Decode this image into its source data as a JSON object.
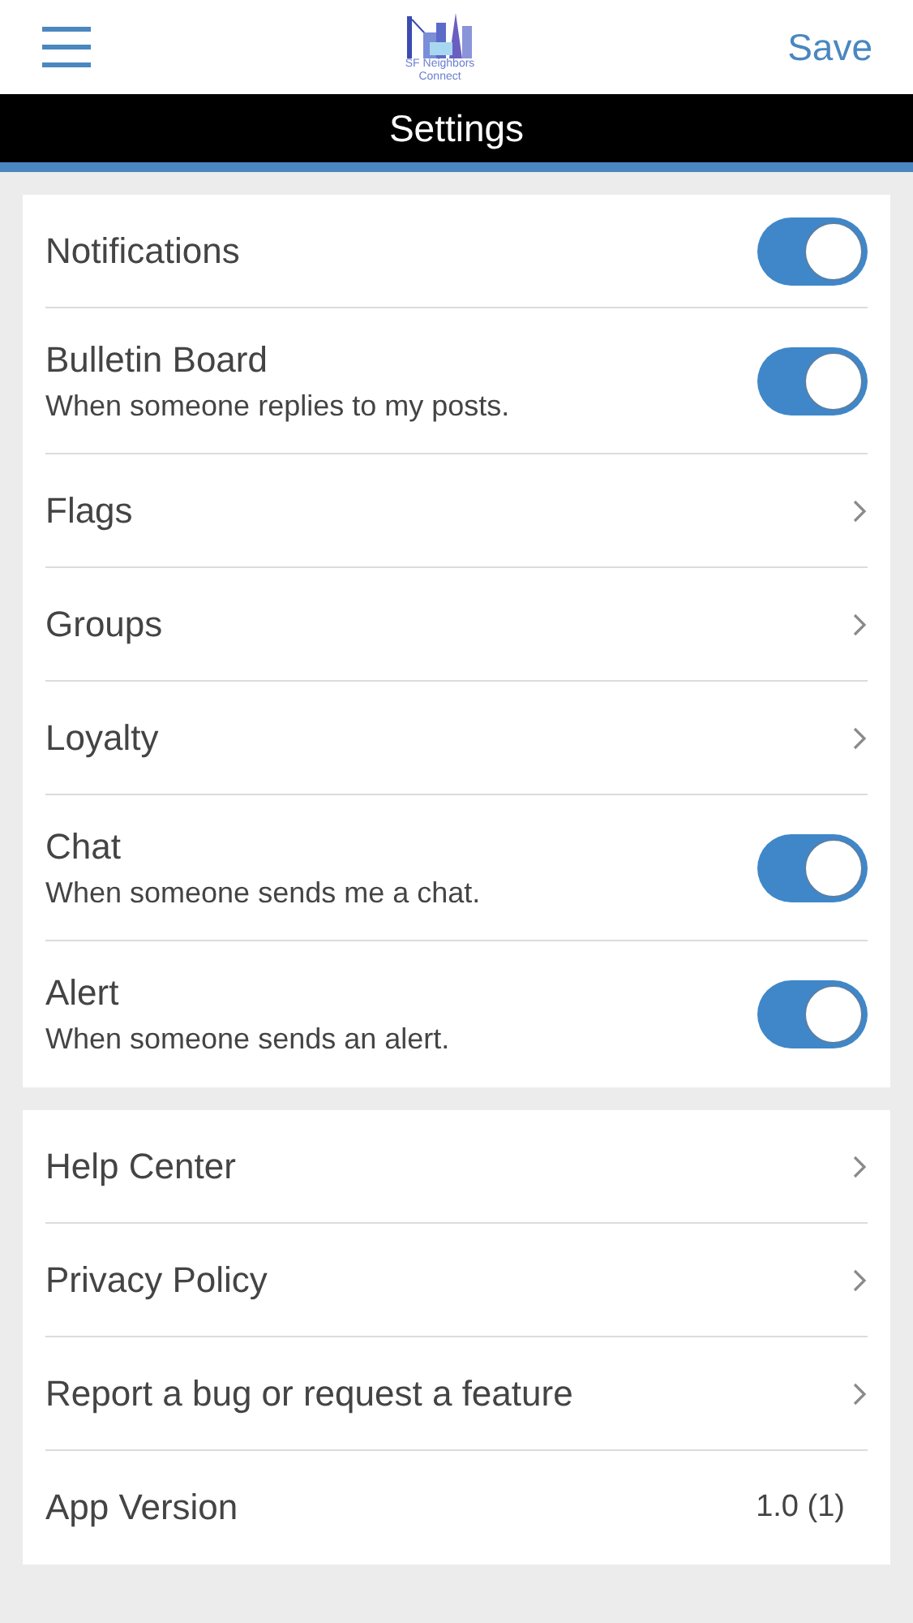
{
  "header": {
    "logo_text": [
      "SF Neighbors",
      "Connect"
    ],
    "save": "Save"
  },
  "title": "Settings",
  "sections": [
    {
      "items": [
        {
          "kind": "toggle",
          "label": "Notifications",
          "on": true
        },
        {
          "kind": "toggle",
          "label": "Bulletin Board",
          "description": "When someone replies to my posts.",
          "on": true
        },
        {
          "kind": "link",
          "label": "Flags"
        },
        {
          "kind": "link",
          "label": "Groups"
        },
        {
          "kind": "link",
          "label": "Loyalty"
        },
        {
          "kind": "toggle",
          "label": "Chat",
          "description": "When someone sends me a chat.",
          "on": true
        },
        {
          "kind": "toggle",
          "label": "Alert",
          "description": "When someone sends an alert.",
          "on": true
        }
      ]
    },
    {
      "items": [
        {
          "kind": "link",
          "label": "Help Center"
        },
        {
          "kind": "link",
          "label": "Privacy Policy"
        },
        {
          "kind": "link",
          "label": "Report a bug or request a feature"
        },
        {
          "kind": "value",
          "label": "App Version",
          "value": "1.0 (1)"
        }
      ]
    }
  ]
}
